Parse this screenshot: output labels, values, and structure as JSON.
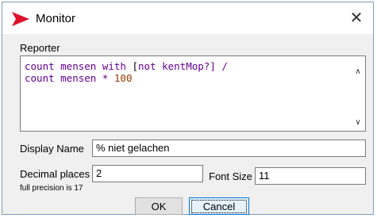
{
  "window": {
    "title": "Monitor"
  },
  "reporter": {
    "label": "Reporter",
    "code": {
      "line1": {
        "a": "count mensen with",
        "b": " [",
        "c": "not kentMop?",
        "d": "] /"
      },
      "line2": {
        "a": "count mensen",
        "b": " * ",
        "c": "100"
      }
    }
  },
  "display_name": {
    "label": "Display Name",
    "value": "% niet gelachen"
  },
  "decimal_places": {
    "label": "Decimal places",
    "value": "2",
    "note": "full precision is 17"
  },
  "font_size": {
    "label": "Font Size",
    "value": "11"
  },
  "buttons": {
    "ok": "OK",
    "cancel": "Cancel"
  },
  "colors": {
    "keyword": "#660096",
    "number": "#963700",
    "icon": "#e0112b"
  }
}
